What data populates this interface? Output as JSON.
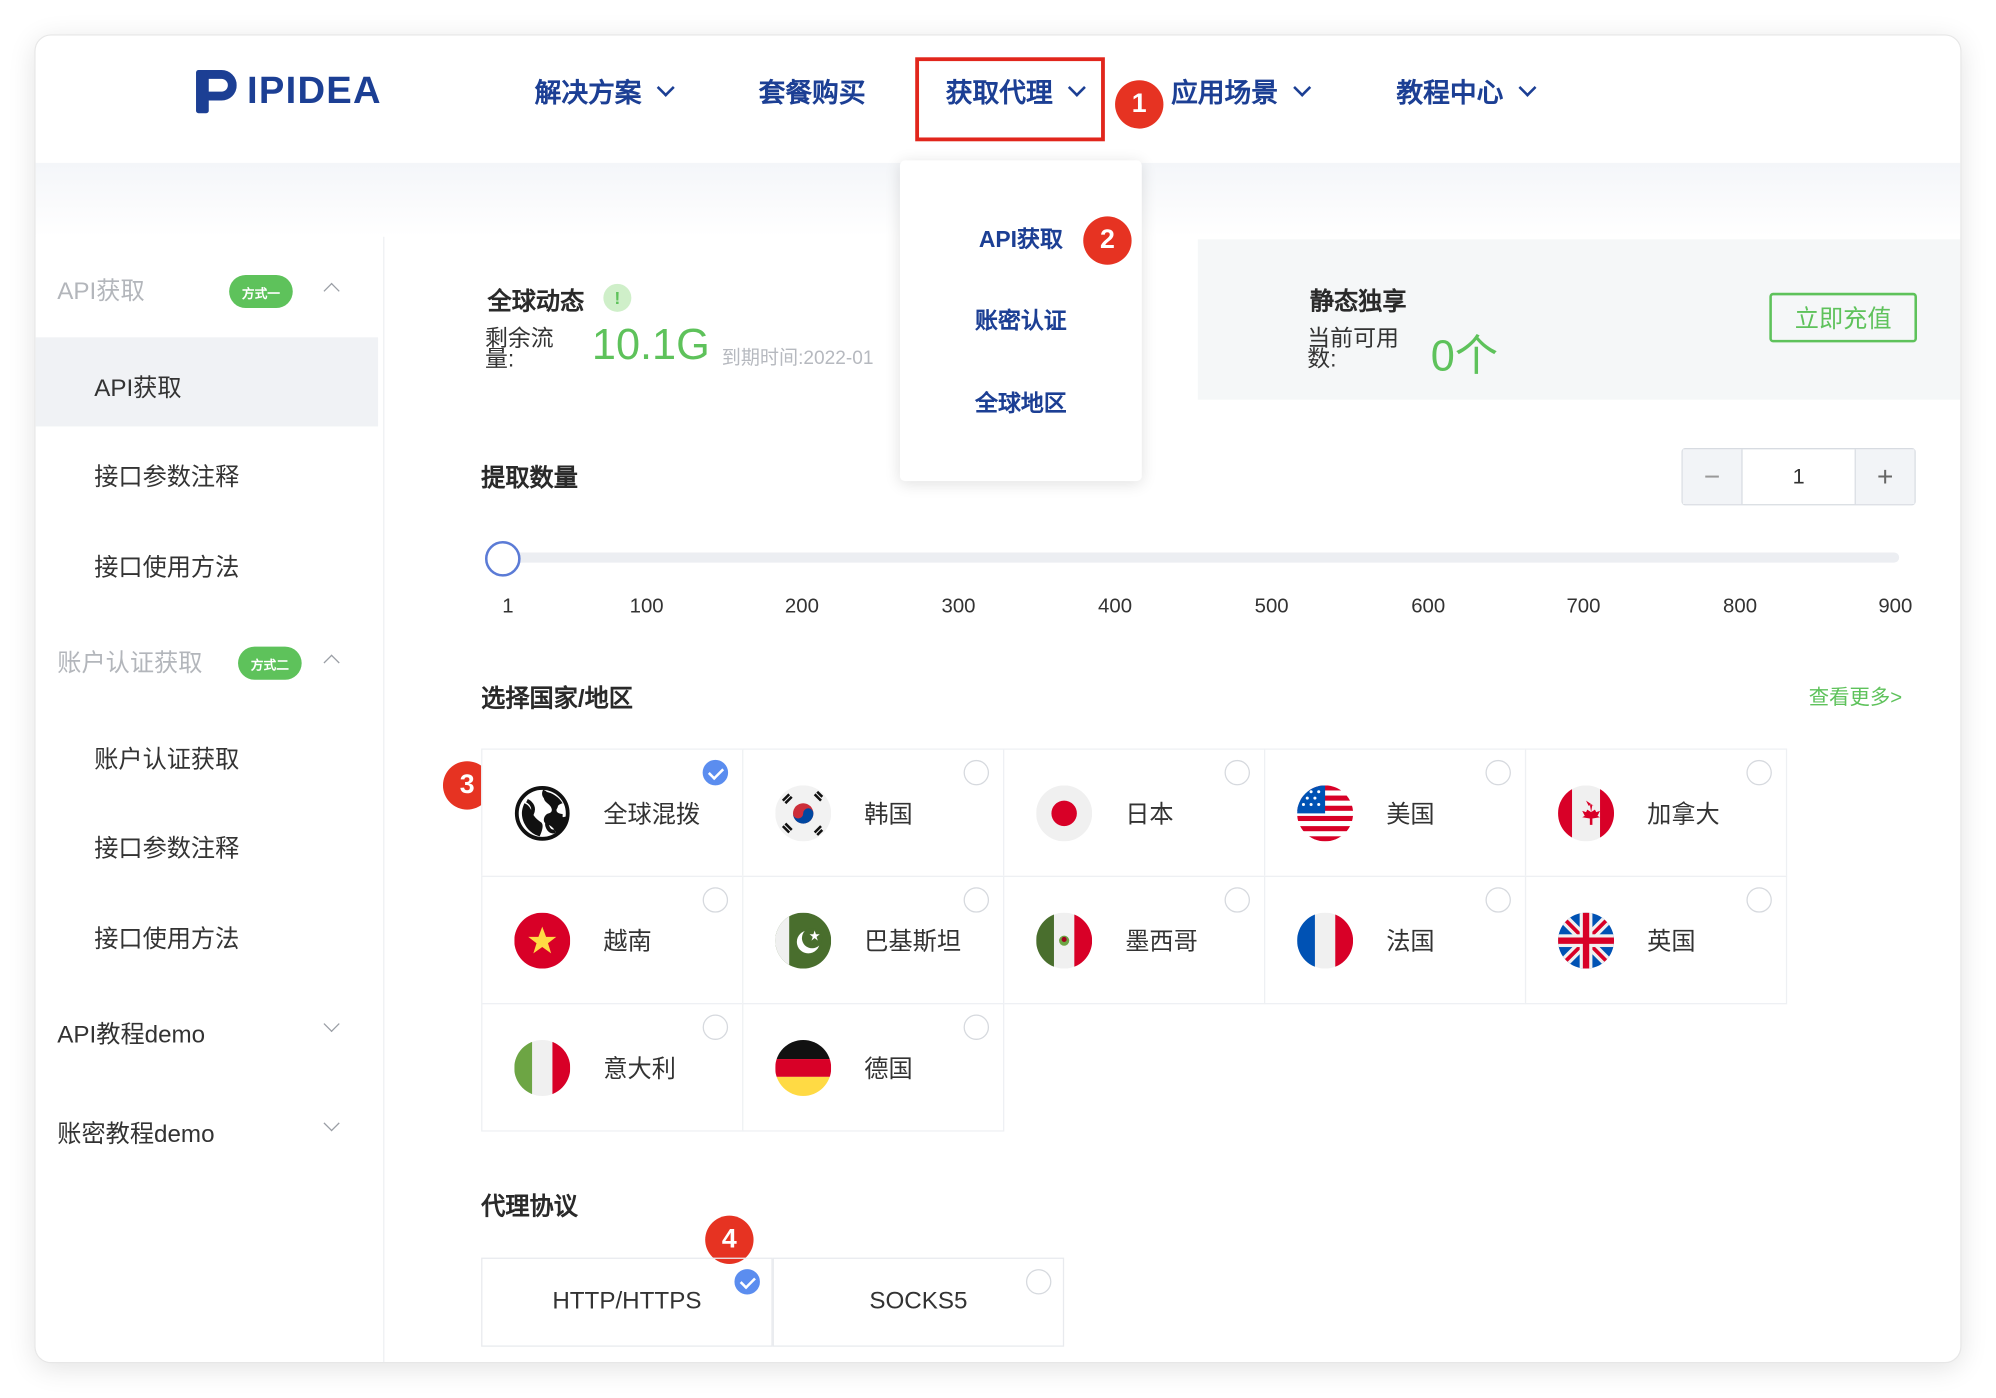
{
  "brand": {
    "name": "IPIDEA",
    "color": "#1c3f94"
  },
  "colors": {
    "accent_green": "#5ec25b",
    "badge_red": "#e63322",
    "highlight_box": "#e1261c",
    "check_blue": "#5b8def"
  },
  "nav": {
    "items": [
      {
        "label": "解决方案",
        "dropdown": true
      },
      {
        "label": "套餐购买",
        "dropdown": false
      },
      {
        "label": "获取代理",
        "dropdown": true
      },
      {
        "label": "应用场景",
        "dropdown": true
      },
      {
        "label": "教程中心",
        "dropdown": true
      }
    ],
    "dropdown_items": [
      "API获取",
      "账密认证",
      "全球地区"
    ]
  },
  "badges": [
    "1",
    "2",
    "3",
    "4"
  ],
  "sidebar": {
    "group1": {
      "label": "API获取",
      "tag": "方式一",
      "items": [
        "API获取",
        "接口参数注释",
        "接口使用方法"
      ]
    },
    "group2": {
      "label": "账户认证获取",
      "tag": "方式二",
      "items": [
        "账户认证获取",
        "接口参数注释",
        "接口使用方法"
      ]
    },
    "parents": [
      "API教程demo",
      "账密教程demo"
    ]
  },
  "dynamic": {
    "title": "全球动态",
    "remaining_label": "剩余流量:",
    "remaining_value": "10.1G",
    "expiry": "到期时间:2022-01"
  },
  "static": {
    "title": "静态独享",
    "available_label": "当前可用数:",
    "available_value": "0个",
    "recharge_label": "立即充值"
  },
  "quantity": {
    "label": "提取数量",
    "value": "1",
    "minus": "−",
    "plus": "+",
    "slider_value": 1,
    "ticks": [
      "1",
      "100",
      "200",
      "300",
      "400",
      "500",
      "600",
      "700",
      "800",
      "900"
    ]
  },
  "region": {
    "label": "选择国家/地区",
    "more": "查看更多>",
    "countries": [
      {
        "name": "全球混拨",
        "icon": "globe-icon",
        "selected": true
      },
      {
        "name": "韩国",
        "icon": "flag-kr-icon",
        "selected": false
      },
      {
        "name": "日本",
        "icon": "flag-jp-icon",
        "selected": false
      },
      {
        "name": "美国",
        "icon": "flag-us-icon",
        "selected": false
      },
      {
        "name": "加拿大",
        "icon": "flag-ca-icon",
        "selected": false
      },
      {
        "name": "越南",
        "icon": "flag-vn-icon",
        "selected": false
      },
      {
        "name": "巴基斯坦",
        "icon": "flag-pk-icon",
        "selected": false
      },
      {
        "name": "墨西哥",
        "icon": "flag-mx-icon",
        "selected": false
      },
      {
        "name": "法国",
        "icon": "flag-fr-icon",
        "selected": false
      },
      {
        "name": "英国",
        "icon": "flag-gb-icon",
        "selected": false
      },
      {
        "name": "意大利",
        "icon": "flag-it-icon",
        "selected": false
      },
      {
        "name": "德国",
        "icon": "flag-de-icon",
        "selected": false
      }
    ]
  },
  "protocol": {
    "label": "代理协议",
    "options": [
      {
        "name": "HTTP/HTTPS",
        "selected": true
      },
      {
        "name": "SOCKS5",
        "selected": false
      }
    ]
  }
}
